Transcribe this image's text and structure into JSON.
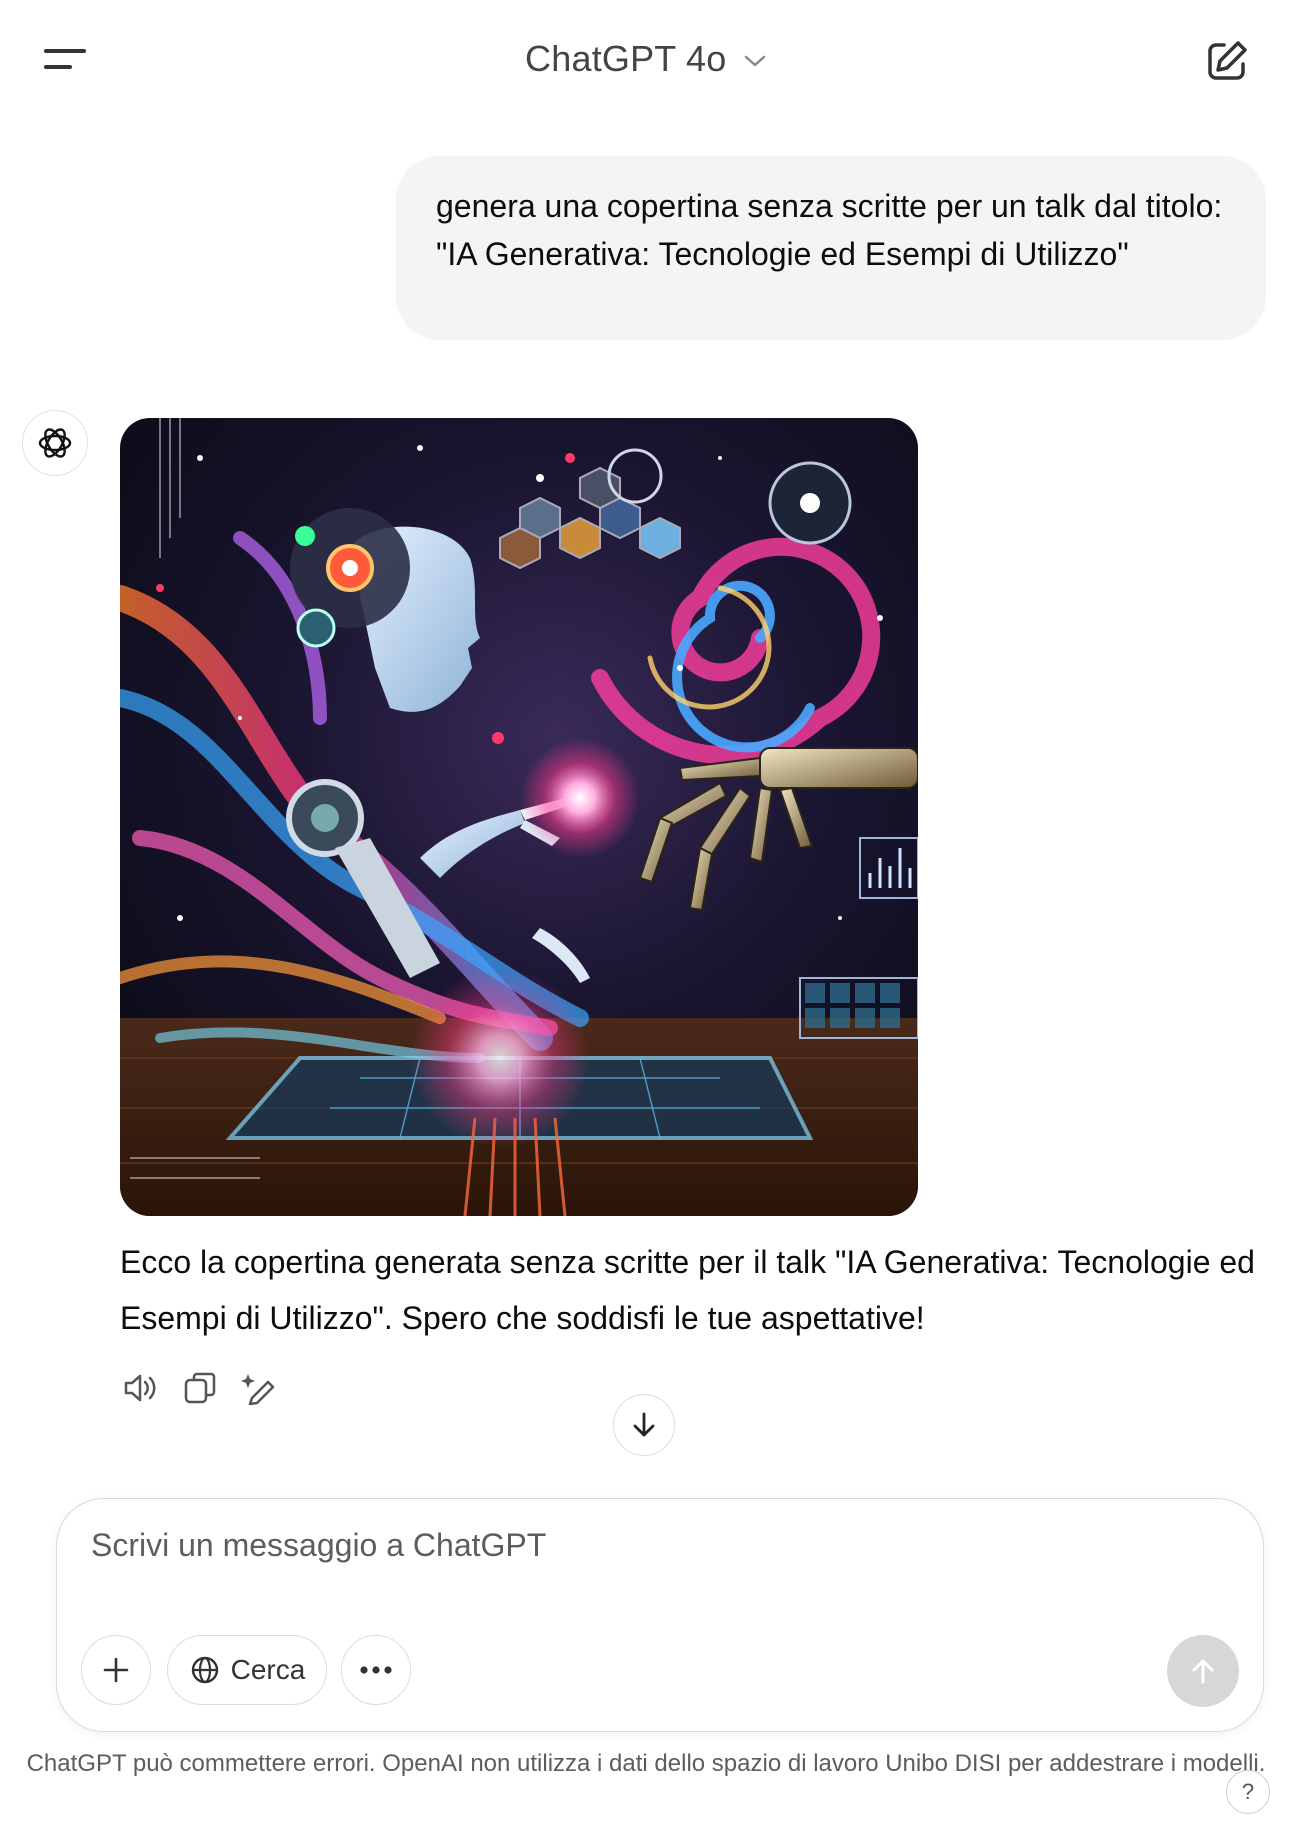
{
  "header": {
    "title": "ChatGPT 4o",
    "menu_icon": "sidebar-menu-icon",
    "new_chat_icon": "new-chat-edit-icon"
  },
  "conversation": {
    "user_message": "genera una copertina senza scritte per un talk dal titolo: \"IA Generativa: Tecnologie ed Esempi di Utilizzo\"",
    "assistant_image_alt": "immagine generata",
    "assistant_message": "Ecco la copertina generata senza scritte per il talk \"IA Generativa: Tecnologie ed Esempi di Utilizzo\". Spero che soddisfi le tue aspettative!",
    "actions": [
      "read-aloud-icon",
      "copy-icon",
      "edit-image-icon"
    ]
  },
  "composer": {
    "placeholder": "Scrivi un messaggio a ChatGPT",
    "search_label": "Cerca"
  },
  "footer": {
    "disclaimer": "ChatGPT può commettere errori. OpenAI non utilizza i dati dello spazio di lavoro Unibo DISI per addestrare i modelli.",
    "help_label": "?"
  },
  "colors": {
    "bubble_bg": "#f4f4f4",
    "send_disabled": "#d7d7d7",
    "text": "#0d0d0d",
    "muted": "#5d5d5d"
  }
}
